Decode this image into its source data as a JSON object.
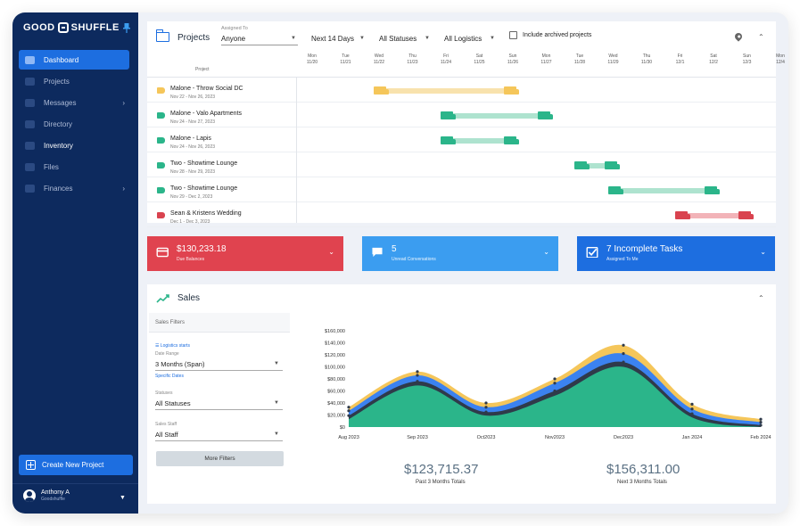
{
  "sidebar": {
    "brand": "GOOD",
    "brand_rest": "SHUFFLE",
    "items": [
      {
        "label": "Dashboard",
        "icon": "dashboard-icon",
        "active": true,
        "chevron": false
      },
      {
        "label": "Projects",
        "icon": "projects-icon",
        "active": false,
        "chevron": false
      },
      {
        "label": "Messages",
        "icon": "messages-icon",
        "active": false,
        "chevron": true
      },
      {
        "label": "Directory",
        "icon": "directory-icon",
        "active": false,
        "chevron": false
      },
      {
        "label": "Inventory",
        "icon": "inventory-icon",
        "active": false,
        "chevron": false
      },
      {
        "label": "Files",
        "icon": "files-icon",
        "active": false,
        "chevron": false
      },
      {
        "label": "Finances",
        "icon": "finances-icon",
        "active": false,
        "chevron": true
      }
    ],
    "create_button": "Create New Project",
    "user": {
      "name": "Anthony A",
      "org": "Goodshuffle"
    }
  },
  "projects": {
    "title": "Projects",
    "assigned_to_label": "Assigned To",
    "assigned_to": "Anyone",
    "range": "Next 14 Days",
    "statuses": "All Statuses",
    "logistics": "All Logistics",
    "include_archived": "Include archived projects",
    "column_header": "Project",
    "days": [
      {
        "dow": "Mon",
        "date": "11/20"
      },
      {
        "dow": "Tue",
        "date": "11/21"
      },
      {
        "dow": "Wed",
        "date": "11/22"
      },
      {
        "dow": "Thu",
        "date": "11/23"
      },
      {
        "dow": "Fri",
        "date": "11/24"
      },
      {
        "dow": "Sat",
        "date": "11/25"
      },
      {
        "dow": "Sun",
        "date": "11/26"
      },
      {
        "dow": "Mon",
        "date": "11/27"
      },
      {
        "dow": "Tue",
        "date": "11/28"
      },
      {
        "dow": "Wed",
        "date": "11/29"
      },
      {
        "dow": "Thu",
        "date": "11/30"
      },
      {
        "dow": "Fri",
        "date": "12/1"
      },
      {
        "dow": "Sat",
        "date": "12/2"
      },
      {
        "dow": "Sun",
        "date": "12/3"
      },
      {
        "dow": "Mon",
        "date": "12/4"
      }
    ],
    "rows": [
      {
        "name": "Malone - Throw Social DC",
        "dates": "Nov 22 - Nov 26, 2023",
        "color": "#f5c65a",
        "bar": "#f8e2ad",
        "start": 2,
        "end": 6
      },
      {
        "name": "Malone - Valo Apartments",
        "dates": "Nov 24 - Nov 27, 2023",
        "color": "#2bb58a",
        "bar": "#aee3cf",
        "start": 4,
        "end": 7
      },
      {
        "name": "Malone - Lapis",
        "dates": "Nov 24 - Nov 26, 2023",
        "color": "#2bb58a",
        "bar": "#aee3cf",
        "start": 4,
        "end": 6
      },
      {
        "name": "Two - Showtime Lounge",
        "dates": "Nov 28 - Nov 29, 2023",
        "color": "#2bb58a",
        "bar": "#aee3cf",
        "start": 8,
        "end": 9
      },
      {
        "name": "Two - Showtime Lounge",
        "dates": "Nov 29 - Dec 2, 2023",
        "color": "#2bb58a",
        "bar": "#aee3cf",
        "start": 9,
        "end": 12
      },
      {
        "name": "Sean & Kristens Wedding",
        "dates": "Dec 1 - Dec 3, 2023",
        "color": "#d9434f",
        "bar": "#f2b3b8",
        "start": 11,
        "end": 13
      }
    ]
  },
  "cards": [
    {
      "title": "$130,233.18",
      "subtitle": "Due Balances",
      "color": "#e0434f",
      "icon": "credit-card-icon"
    },
    {
      "title": "5",
      "subtitle": "Unread Conversations",
      "color": "#3b9df0",
      "icon": "chat-icon"
    },
    {
      "title": "7 Incomplete Tasks",
      "subtitle": "Assigned To Me",
      "color": "#1d6ee0",
      "icon": "checkbox-icon"
    }
  ],
  "sales": {
    "title": "Sales",
    "filters_title": "Sales Filters",
    "logistics_link": "☰ Logistics starts",
    "date_range_label": "Date Range",
    "date_range": "3 Months (Span)",
    "specific_dates": "Specific Dates",
    "statuses_label": "Statuses",
    "statuses": "All Statuses",
    "staff_label": "Sales Staff",
    "staff": "All Staff",
    "more_filters": "More Filters",
    "totals": [
      {
        "value": "$123,715.37",
        "label": "Past 3 Months Totals"
      },
      {
        "value": "$156,311.00",
        "label": "Next 3 Months Totals"
      }
    ]
  },
  "chart_data": {
    "type": "area",
    "title": "",
    "xlabel": "",
    "ylabel": "",
    "categories": [
      "Aug 2023",
      "Sep 2023",
      "Oct2023",
      "Nov2023",
      "Dec2023",
      "Jan 2024",
      "Feb 2024"
    ],
    "ylim": [
      0,
      160000
    ],
    "yticks": [
      "$0",
      "$20,000",
      "$40,000",
      "$60,000",
      "$80,000",
      "$100,000",
      "$120,000",
      "$140,000",
      "$160,000"
    ],
    "series": [
      {
        "color": "#2bb58a",
        "values": [
          13000,
          69000,
          19000,
          52000,
          100000,
          16000,
          0
        ]
      },
      {
        "color": "#2f3a4a",
        "values": [
          19000,
          76000,
          25000,
          60000,
          108000,
          22000,
          3000
        ]
      },
      {
        "color": "#3b82f0",
        "values": [
          27000,
          86000,
          33000,
          73000,
          122000,
          30000,
          8000
        ]
      },
      {
        "color": "#f5c65a",
        "values": [
          33000,
          92000,
          40000,
          80000,
          136000,
          38000,
          13000
        ]
      }
    ]
  }
}
